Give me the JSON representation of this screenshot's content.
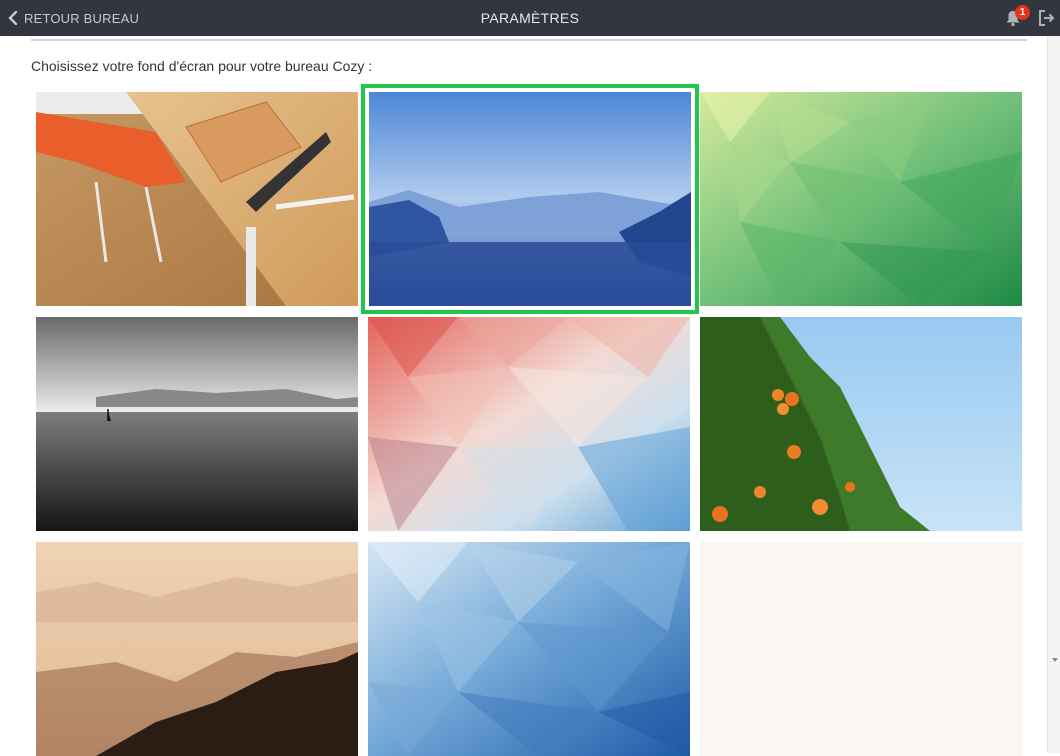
{
  "topbar": {
    "back_label": "RETOUR BUREAU",
    "title": "PARAMÈTRES",
    "notification_count": "1",
    "accent": "#32363f"
  },
  "main": {
    "prompt": "Choisissez votre fond d'écran pour votre bureau Cozy :",
    "selected_color": "#21c74b",
    "wallpapers": [
      {
        "name": "desk-wood",
        "selected": false
      },
      {
        "name": "blue-lake-mountains",
        "selected": true
      },
      {
        "name": "green-polygons",
        "selected": false
      },
      {
        "name": "black-white-sea",
        "selected": false
      },
      {
        "name": "pink-blue-polygons",
        "selected": false
      },
      {
        "name": "orange-tree-sky",
        "selected": false
      },
      {
        "name": "misty-hills-sepia",
        "selected": false
      },
      {
        "name": "blue-polygons",
        "selected": false
      },
      {
        "name": "plain-cream",
        "selected": false
      }
    ]
  }
}
